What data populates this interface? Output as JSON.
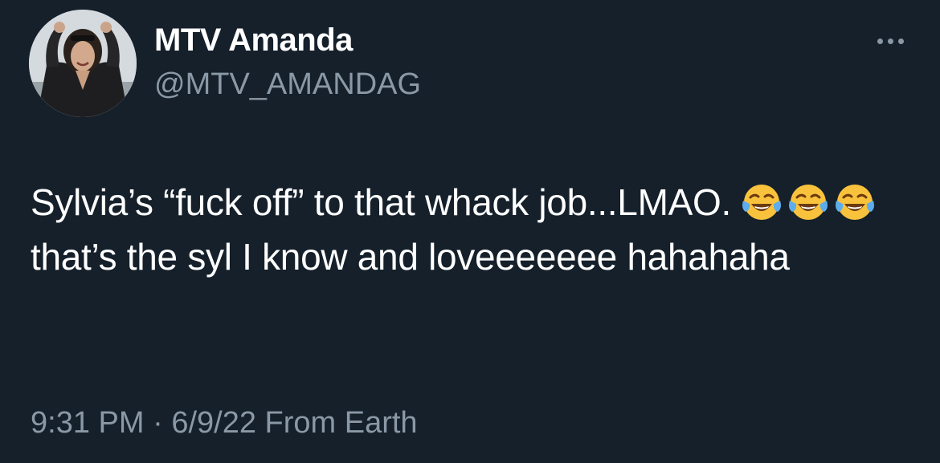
{
  "colors": {
    "background": "#15202b",
    "primary_text": "#ffffff",
    "secondary_text": "#8b98a5"
  },
  "author": {
    "display_name": "MTV Amanda",
    "handle": "@MTV_AMANDAG",
    "avatar_icon": "profile-photo"
  },
  "menu": {
    "more_icon": "more-horizontal-icon"
  },
  "tweet": {
    "text_part1": "Sylvia’s “fuck off” to that whack job...LMAO. ",
    "text_part2": " that’s the syl I know and loveeeeeee hahahaha",
    "emoji_name": "face-with-tears-of-joy"
  },
  "footer": {
    "time": "9:31 PM",
    "separator": "·",
    "date": "6/9/22",
    "source": "From Earth"
  }
}
